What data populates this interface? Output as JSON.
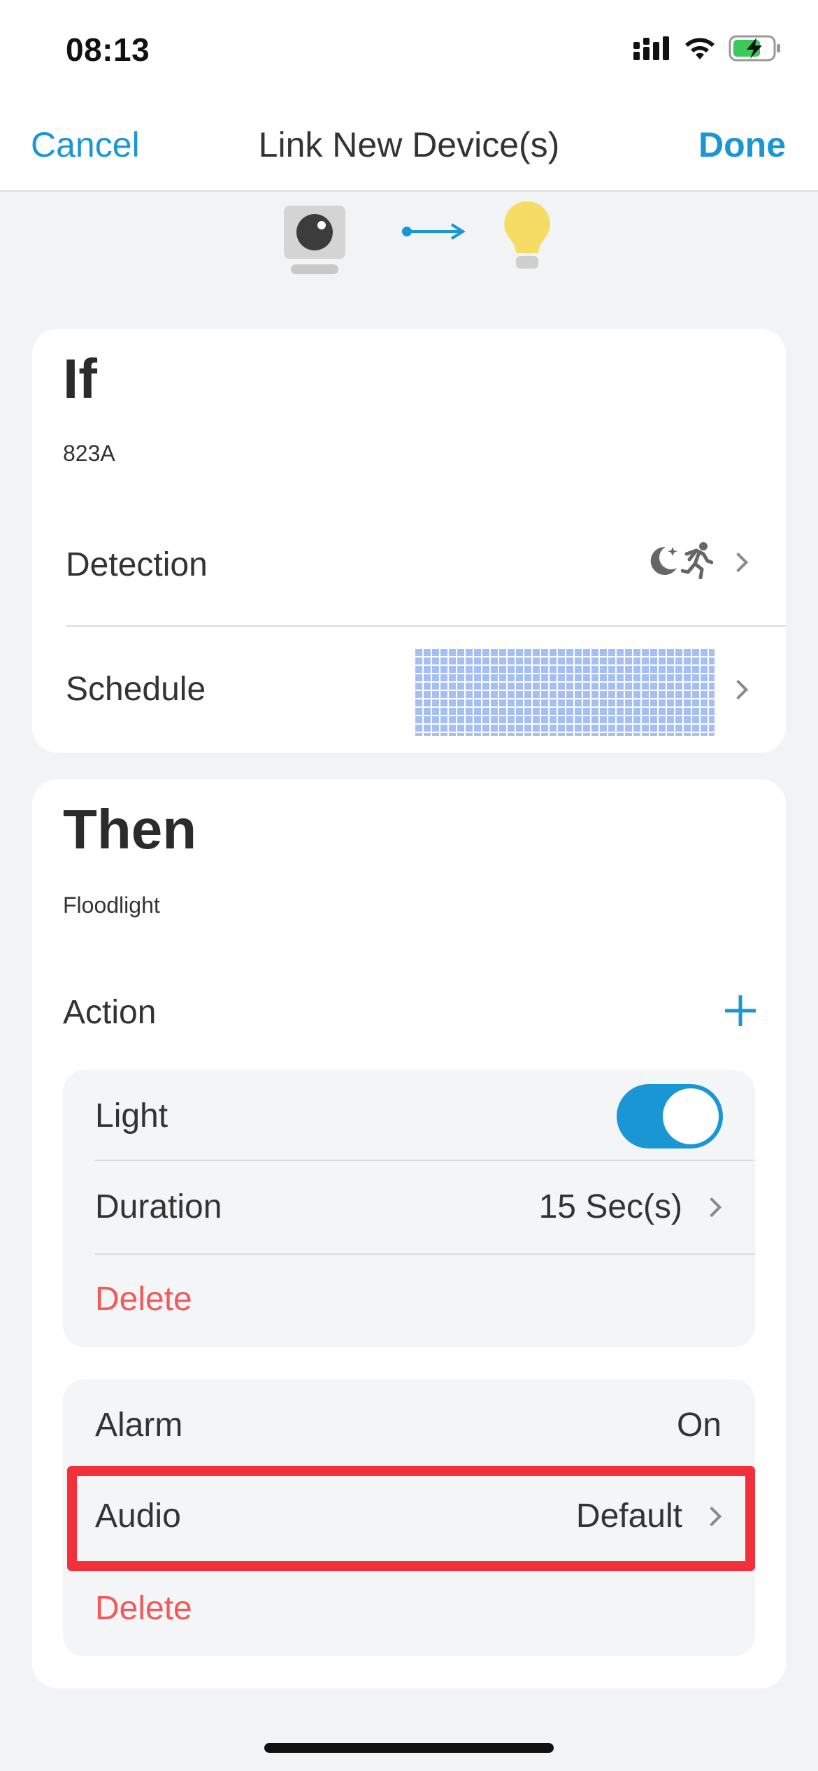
{
  "status_bar": {
    "time": "08:13",
    "icons": [
      "signal-icon",
      "wifi-icon",
      "battery-charging-icon"
    ]
  },
  "nav": {
    "cancel_label": "Cancel",
    "title": "Link New Device(s)",
    "done_label": "Done"
  },
  "header_icons": [
    "camera-icon",
    "arrow-right-icon",
    "light-bulb-icon"
  ],
  "if_card": {
    "heading": "If",
    "device": "823A",
    "detection_label": "Detection",
    "detection_icons": [
      "moon-icon",
      "running-person-icon"
    ],
    "schedule_label": "Schedule"
  },
  "then_card": {
    "heading": "Then",
    "device": "Floodlight",
    "action_label": "Action",
    "light_action": {
      "label": "Light",
      "toggle_on": true,
      "duration_label": "Duration",
      "duration_value": "15 Sec(s)",
      "delete_label": "Delete"
    },
    "alarm_action": {
      "label": "Alarm",
      "value": "On",
      "audio_label": "Audio",
      "audio_value": "Default",
      "delete_label": "Delete"
    }
  },
  "colors": {
    "accent": "#1a96d4",
    "delete": "#f05a5a",
    "highlight": "#f2303a",
    "schedule": "#a5bff5",
    "bulb": "#f5dc64"
  }
}
